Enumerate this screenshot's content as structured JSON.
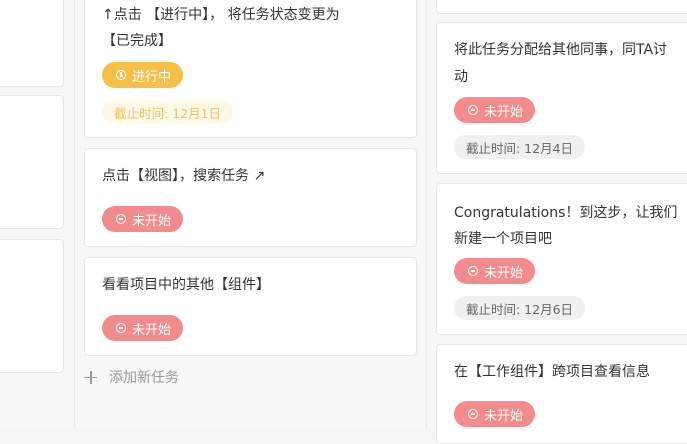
{
  "middle_column": {
    "cards": [
      {
        "lines": [
          "↑点击 【进行中】， 将任务状态变更为",
          "【已完成】"
        ],
        "status": "进行中",
        "due": "截止时间: 12月1日"
      },
      {
        "lines": [
          "点击【视图】，搜索任务 ↗"
        ],
        "status": "未开始"
      },
      {
        "lines": [
          "看看项目中的其他【组件】"
        ],
        "status": "未开始"
      }
    ],
    "add_task_label": "添加新任务"
  },
  "right_column": {
    "cards": [
      {
        "lines": [
          "将此任务分配给其他同事，同TA讨",
          "动"
        ],
        "status": "未开始",
        "due": "截止时间: 12月4日"
      },
      {
        "lines": [
          "Congratulations！到这步，让我们",
          "新建一个项目吧"
        ],
        "status": "未开始",
        "due": "截止时间: 12月6日"
      },
      {
        "lines": [
          "在【工作组件】跨项目查看信息"
        ],
        "status": "未开始"
      }
    ]
  },
  "colors": {
    "in_progress": "#f4c04a",
    "not_started": "#f28b8b",
    "due_yellow_text": "#f0c35e"
  }
}
